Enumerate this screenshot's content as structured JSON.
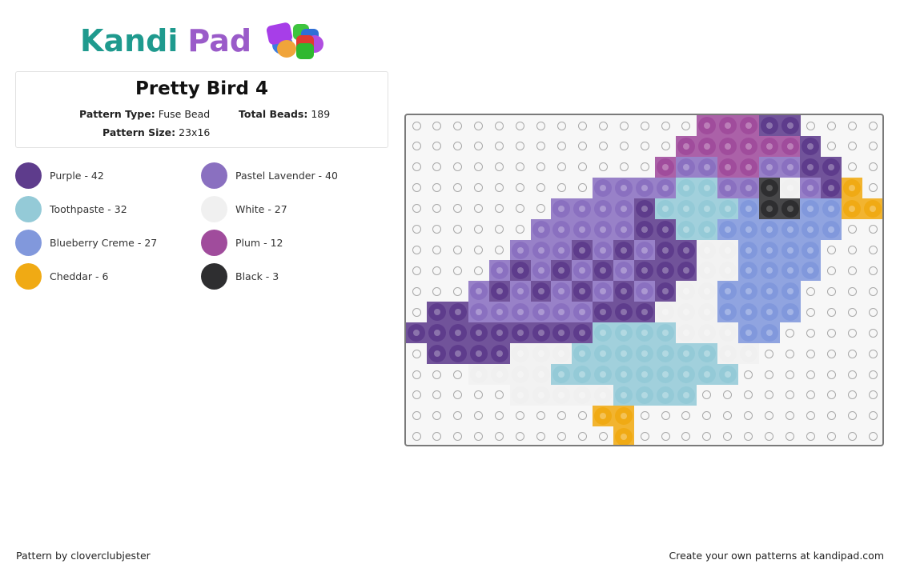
{
  "logo": {
    "part1": "Kandi",
    "part2": "Pad"
  },
  "pattern": {
    "title": "Pretty Bird 4",
    "type_label": "Pattern Type:",
    "type_value": "Fuse Bead",
    "beads_label": "Total Beads:",
    "beads_value": "189",
    "size_label": "Pattern Size:",
    "size_value": "23x16"
  },
  "legend": [
    {
      "code": "P",
      "name": "Purple",
      "count": 42,
      "label": "Purple - 42",
      "color": "#5e3c8c"
    },
    {
      "code": "L",
      "name": "Pastel Lavender",
      "count": 40,
      "label": "Pastel Lavender - 40",
      "color": "#8a70c0"
    },
    {
      "code": "T",
      "name": "Toothpaste",
      "count": 32,
      "label": "Toothpaste - 32",
      "color": "#94cad7"
    },
    {
      "code": "W",
      "name": "White",
      "count": 27,
      "label": "White - 27",
      "color": "#f0f0f0"
    },
    {
      "code": "B",
      "name": "Blueberry Creme",
      "count": 27,
      "label": "Blueberry Creme - 27",
      "color": "#8198dc"
    },
    {
      "code": "M",
      "name": "Plum",
      "count": 12,
      "label": "Plum - 12",
      "color": "#a04c9c"
    },
    {
      "code": "C",
      "name": "Cheddar",
      "count": 6,
      "label": "Cheddar - 6",
      "color": "#f0aa14"
    },
    {
      "code": "K",
      "name": "Black",
      "count": 3,
      "label": "Black - 3",
      "color": "#2e2e30"
    }
  ],
  "grid": {
    "columns": 23,
    "rows": 16,
    "cells": [
      "..............MMMPP....",
      ".............MMMMMMP...",
      "............MLLMMLLPP..",
      ".........LLLLTTLLKWLPC.",
      ".......LLLLPTTTTBKKBBCC",
      "......LLLLLPPTTBBBBBB..",
      ".....LLLPLPLPPWWBBBB...",
      "....LPLPLPLPPPWWBBBB...",
      "...LPLPLPLPLPWWBBBB....",
      ".PPLLLLLLPPPWWWBBBB....",
      "PPPPPPPPPTTTTWWWBB.....",
      ".PPPPWWWTTTTTTTWW......",
      "...WWWWTTTTTTTTT.......",
      ".....WWWWWTTTT.........",
      ".........CC............",
      "..........C............"
    ]
  },
  "footer": {
    "credit": "Pattern by cloverclubjester",
    "promo": "Create your own patterns at kandipad.com"
  }
}
